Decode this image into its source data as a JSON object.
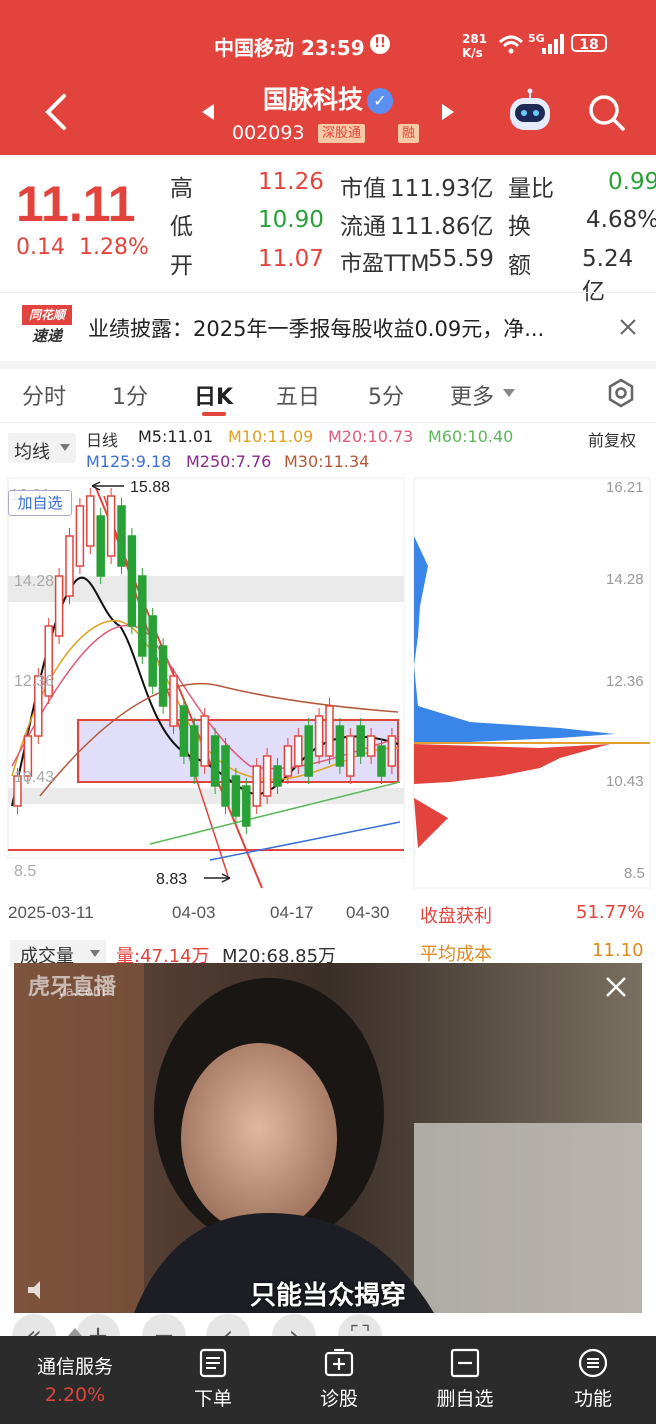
{
  "status_bar": {
    "carrier": "中国移动",
    "time": "23:59",
    "speed_value": "281",
    "speed_unit": "K/s",
    "network": "5G",
    "battery": "18"
  },
  "header": {
    "stock_name": "国脉科技",
    "stock_code": "002093",
    "tag_exchange": "深股通",
    "tag_margin": "融"
  },
  "quote": {
    "price": "11.11",
    "change": "0.14",
    "change_pct": "1.28%",
    "high_label": "高",
    "high": "11.26",
    "low_label": "低",
    "low": "10.90",
    "open_label": "开",
    "open": "11.07",
    "mcap_label": "市值",
    "mcap": "111.93亿",
    "float_label": "流通",
    "float": "111.86亿",
    "pe_label": "市盈TTM",
    "pe": "55.59",
    "vr_label": "量比",
    "vr": "0.99",
    "turnover_label": "换",
    "turnover": "4.68%",
    "amount_label": "额",
    "amount": "5.24亿"
  },
  "news": {
    "logo_top": "同花顺",
    "logo_bottom": "速递",
    "text": "业绩披露：2025年一季报每股收益0.09元，净..."
  },
  "tabs": [
    "分时",
    "1分",
    "日K",
    "五日",
    "5分",
    "更多"
  ],
  "chart_header": {
    "indicator": "均线",
    "period": "日线",
    "adjust": "前复权",
    "m5": "M5:11.01",
    "m10": "M10:11.09",
    "m20": "M20:10.73",
    "m60": "M60:10.40",
    "m125": "M125:9.18",
    "m250": "M250:7.76",
    "m30": "M30:11.34",
    "add_watch": "加自选"
  },
  "chart_data": {
    "type": "candlestick",
    "y_axis_ticks": [
      "16.21",
      "14.28",
      "12.36",
      "10.43",
      "8.5"
    ],
    "x_axis_ticks": [
      "2025-03-11",
      "04-03",
      "04-17",
      "04-30"
    ],
    "annotations": {
      "high": "15.88",
      "low": "8.83"
    },
    "ylim": [
      8.5,
      16.21
    ]
  },
  "chip_panel": {
    "profit_label": "收盘获利",
    "profit": "51.77%",
    "avg_cost_label": "平均成本",
    "avg_cost": "11.10"
  },
  "volume": {
    "label": "成交量",
    "vol": "量:47.14万",
    "m20": "M20:68.85万"
  },
  "video": {
    "watermark": "虎牙直播",
    "watermark_sub": "ya.com",
    "subtitle": "只能当众揭穿"
  },
  "bottom_nav": {
    "sector": "通信服务",
    "sector_pct": "2.20%",
    "items": [
      "下单",
      "诊股",
      "删自选",
      "功能"
    ]
  },
  "colors": {
    "brand": "#e2443d",
    "up": "#e2443d",
    "down": "#2aa137"
  }
}
